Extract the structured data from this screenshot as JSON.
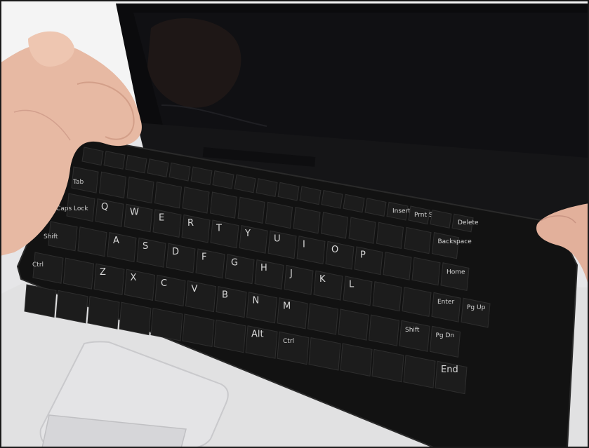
{
  "photo": {
    "subject": "keyboard-removal-photo",
    "keyboard": {
      "function_row": [
        "Insert",
        "Prnt Scrn",
        "Delete"
      ],
      "number_row": [
        "Backspace"
      ],
      "row_q": [
        "Q",
        "W",
        "E",
        "R",
        "T",
        "Y",
        "U",
        "I",
        "O",
        "P",
        "Home"
      ],
      "row_a": [
        "A",
        "S",
        "D",
        "F",
        "G",
        "H",
        "J",
        "K",
        "L",
        "Enter",
        "Pg Up"
      ],
      "row_z": [
        "Z",
        "X",
        "C",
        "V",
        "B",
        "N",
        "M",
        "Shift",
        "Pg Dn"
      ],
      "bottom_row": [
        "Alt",
        "Ctrl",
        "End"
      ],
      "left_modifiers": [
        "Tab",
        "Caps Lock",
        "Shift",
        "Ctrl"
      ]
    },
    "colors": {
      "background": "#ffffff",
      "laptop_body": "#e6e6e8",
      "screen": "#0c0c0e",
      "keyboard": "#141414",
      "key": "#1c1c1c",
      "skin": "#e7b9a3"
    }
  }
}
